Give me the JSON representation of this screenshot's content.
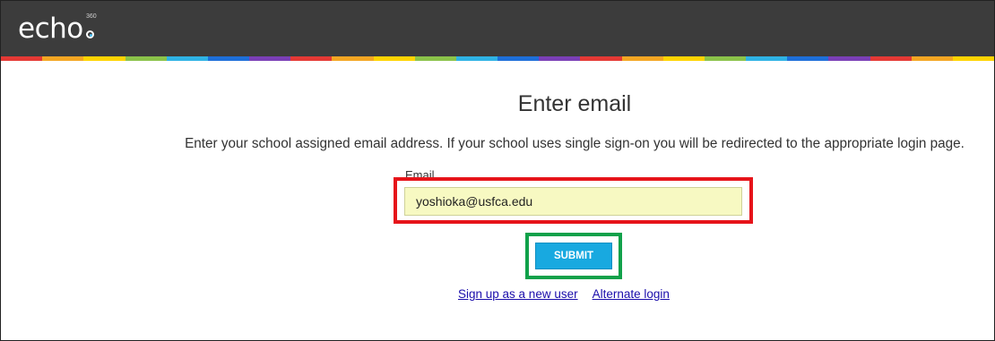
{
  "header": {
    "logo_text": "echo",
    "logo_superscript": "360",
    "background_color": "#3c3c3c",
    "stripe_colors": [
      "#e53935",
      "#f4a623",
      "#ffd400",
      "#8bc34a",
      "#2fb3e5",
      "#1e6fd9",
      "#7b3fb6",
      "#e53935",
      "#f4a623",
      "#ffd400",
      "#8bc34a",
      "#2fb3e5",
      "#1e6fd9",
      "#7b3fb6",
      "#e53935",
      "#f4a623",
      "#ffd400",
      "#8bc34a",
      "#2fb3e5",
      "#1e6fd9",
      "#7b3fb6",
      "#e53935",
      "#f4a623",
      "#ffd400"
    ]
  },
  "main": {
    "title": "Enter email",
    "description": "Enter your school assigned email address. If your school uses single sign-on you will be redirected to the appropriate login page.",
    "email_label": "Email",
    "email_value": "yoshioka@usfca.edu",
    "submit_label": "SUBMIT",
    "links": {
      "sign_up": "Sign up as a new user",
      "alternate_login": "Alternate login"
    }
  },
  "annotations": {
    "email_highlight_color": "#e6141a",
    "submit_highlight_color": "#10a14a"
  }
}
